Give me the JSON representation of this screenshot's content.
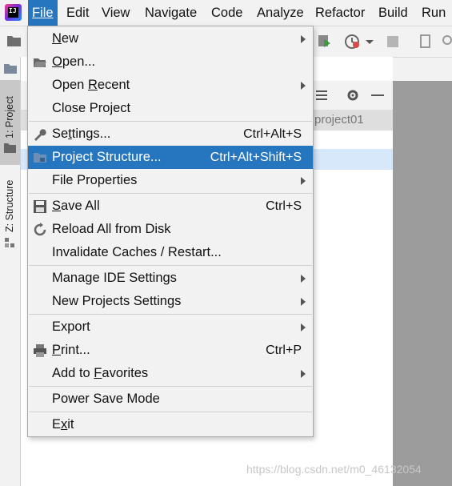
{
  "menubar": {
    "items": [
      {
        "label": "File"
      },
      {
        "label": "Edit"
      },
      {
        "label": "View"
      },
      {
        "label": "Navigate"
      },
      {
        "label": "Code"
      },
      {
        "label": "Analyze"
      },
      {
        "label": "Refactor"
      },
      {
        "label": "Build"
      },
      {
        "label": "Run"
      }
    ],
    "active_index": 0
  },
  "sidebar": {
    "tabs": [
      {
        "label": "1: Project"
      },
      {
        "label": "Z: Structure"
      }
    ]
  },
  "project_panel": {
    "breadcrumb_text": "project01"
  },
  "file_menu": {
    "items": [
      {
        "label": "New",
        "mnemonic": "N",
        "shortcut": "",
        "submenu": true,
        "icon": ""
      },
      {
        "label": "Open...",
        "mnemonic": "O",
        "shortcut": "",
        "submenu": false,
        "icon": "folder-open-icon"
      },
      {
        "label": "Open Recent",
        "mnemonic": "R",
        "shortcut": "",
        "submenu": true,
        "icon": ""
      },
      {
        "label": "Close Project",
        "mnemonic": "",
        "shortcut": "",
        "submenu": false,
        "icon": ""
      },
      {
        "label": "Settings...",
        "mnemonic": "t",
        "shortcut": "Ctrl+Alt+S",
        "submenu": false,
        "icon": "wrench-icon"
      },
      {
        "label": "Project Structure...",
        "mnemonic": "",
        "shortcut": "Ctrl+Alt+Shift+S",
        "submenu": false,
        "icon": "project-structure-icon",
        "highlighted": true
      },
      {
        "label": "File Properties",
        "mnemonic": "",
        "shortcut": "",
        "submenu": true,
        "icon": ""
      },
      {
        "label": "Save All",
        "mnemonic": "S",
        "shortcut": "Ctrl+S",
        "submenu": false,
        "icon": "save-icon"
      },
      {
        "label": "Reload All from Disk",
        "mnemonic": "",
        "shortcut": "",
        "submenu": false,
        "icon": "reload-icon"
      },
      {
        "label": "Invalidate Caches / Restart...",
        "mnemonic": "",
        "shortcut": "",
        "submenu": false,
        "icon": ""
      },
      {
        "label": "Manage IDE Settings",
        "mnemonic": "",
        "shortcut": "",
        "submenu": true,
        "icon": ""
      },
      {
        "label": "New Projects Settings",
        "mnemonic": "",
        "shortcut": "",
        "submenu": true,
        "icon": ""
      },
      {
        "label": "Export",
        "mnemonic": "",
        "shortcut": "",
        "submenu": true,
        "icon": ""
      },
      {
        "label": "Print...",
        "mnemonic": "P",
        "shortcut": "Ctrl+P",
        "submenu": false,
        "icon": "print-icon"
      },
      {
        "label": "Add to Favorites",
        "mnemonic": "F",
        "shortcut": "",
        "submenu": true,
        "icon": ""
      },
      {
        "label": "Power Save Mode",
        "mnemonic": "",
        "shortcut": "",
        "submenu": false,
        "icon": ""
      },
      {
        "label": "Exit",
        "mnemonic": "x",
        "shortcut": "",
        "submenu": false,
        "icon": ""
      }
    ]
  },
  "watermark": "https://blog.csdn.net/m0_46132054",
  "colors": {
    "highlight": "#2675bf",
    "menu_bg": "#f2f2f2",
    "selection_row": "#d7e8fb"
  }
}
